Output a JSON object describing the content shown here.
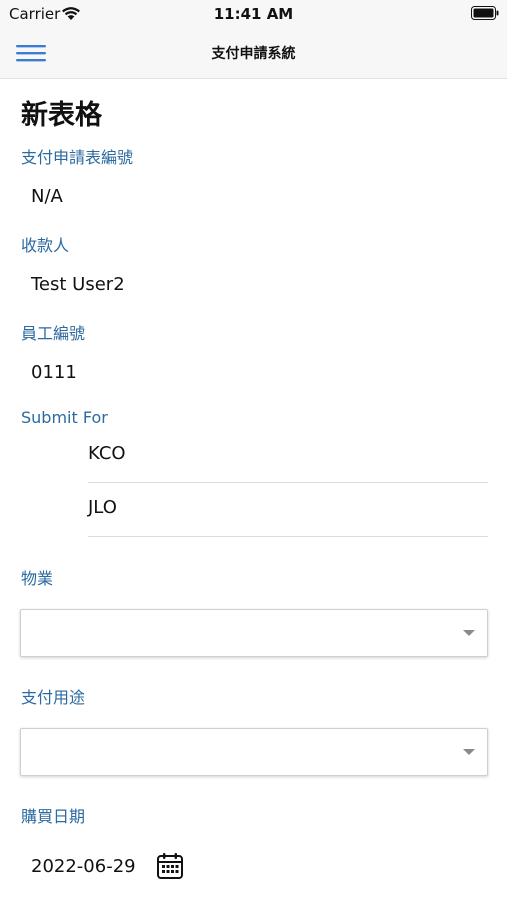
{
  "status_bar": {
    "carrier": "Carrier",
    "time": "11:41 AM"
  },
  "nav": {
    "title": "支付申請系統",
    "menu_icon": "hamburger-menu-icon"
  },
  "form": {
    "title": "新表格",
    "fields": {
      "application_no": {
        "label": "支付申請表編號",
        "value": "N/A"
      },
      "payee": {
        "label": "收款人",
        "value": "Test User2"
      },
      "employee_no": {
        "label": "員工編號",
        "value": "0111"
      },
      "submit_for": {
        "label": "Submit For",
        "options": [
          "KCO",
          "JLO"
        ]
      },
      "property": {
        "label": "物業",
        "selected": ""
      },
      "purpose": {
        "label": "支付用途",
        "selected": ""
      },
      "purchase_date": {
        "label": "購買日期",
        "value": "2022-06-29",
        "icon": "calendar-icon"
      }
    }
  },
  "colors": {
    "label_blue": "#2c6aa0",
    "menu_blue": "#3a7bd5",
    "bar_background": "#f7f7f7"
  }
}
